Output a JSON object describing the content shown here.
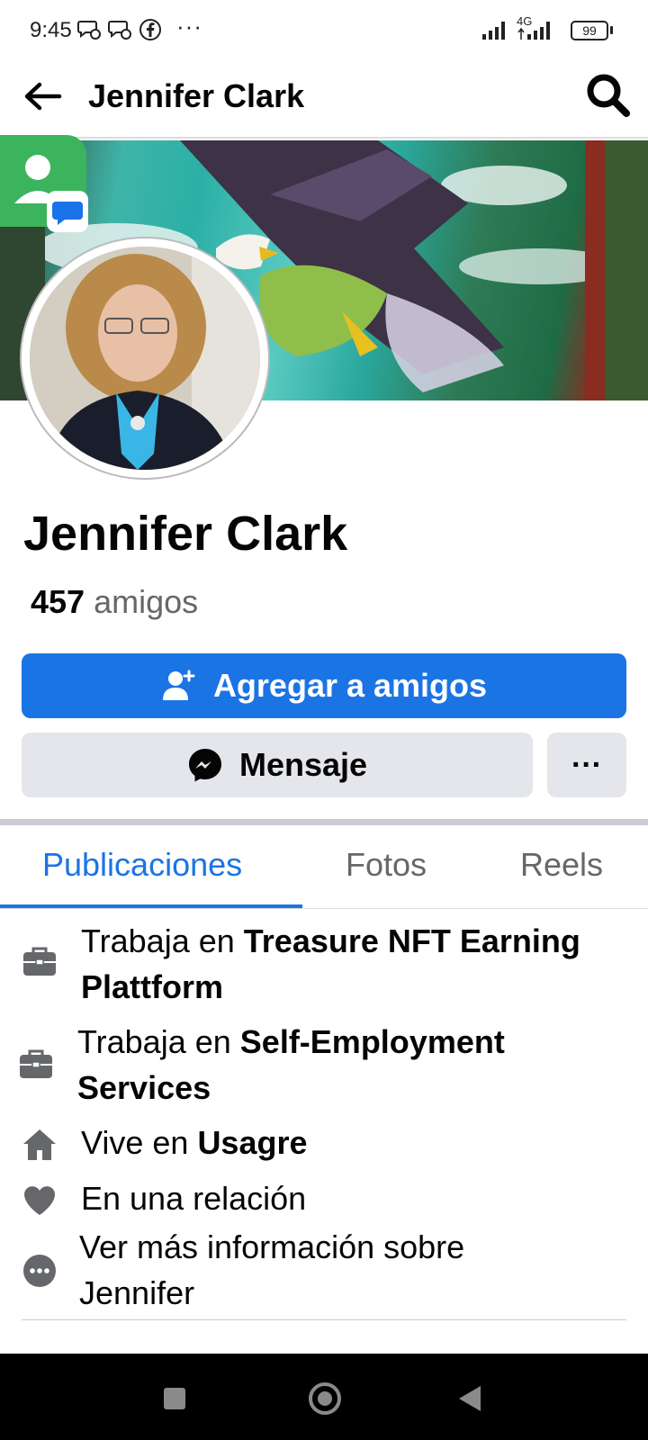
{
  "status_bar": {
    "time": "9:45",
    "network": "4G",
    "battery": "99",
    "notification_icons": [
      "chat-bubble-icon",
      "chat-bubble-icon",
      "facebook-icon"
    ],
    "more_dots": "···"
  },
  "header": {
    "title": "Jennifer Clark",
    "back_icon": "arrow-left-icon",
    "search_icon": "search-icon"
  },
  "profile": {
    "name": "Jennifer Clark",
    "friends_count": "457",
    "friends_label": "amigos"
  },
  "actions": {
    "add_friend_label": "Agregar a amigos",
    "message_label": "Mensaje",
    "more_label": "···"
  },
  "tabs": [
    {
      "label": "Publicaciones",
      "active": true
    },
    {
      "label": "Fotos",
      "active": false
    },
    {
      "label": "Reels",
      "active": false
    }
  ],
  "details": [
    {
      "icon": "briefcase-icon",
      "prefix": "Trabaja en ",
      "bold": "Treasure NFT Earning Plattform"
    },
    {
      "icon": "briefcase-icon",
      "prefix": "Trabaja en ",
      "bold": "Self-Employment Services"
    },
    {
      "icon": "home-icon",
      "prefix": "Vive en ",
      "bold": "Usagre"
    },
    {
      "icon": "heart-icon",
      "prefix": "En una relación",
      "bold": ""
    },
    {
      "icon": "more-circle-icon",
      "prefix": "Ver más información sobre Jennifer",
      "bold": ""
    }
  ],
  "colors": {
    "accent": "#1b74e4",
    "secondary_button": "#e4e6eb",
    "muted_text": "#65676b"
  }
}
